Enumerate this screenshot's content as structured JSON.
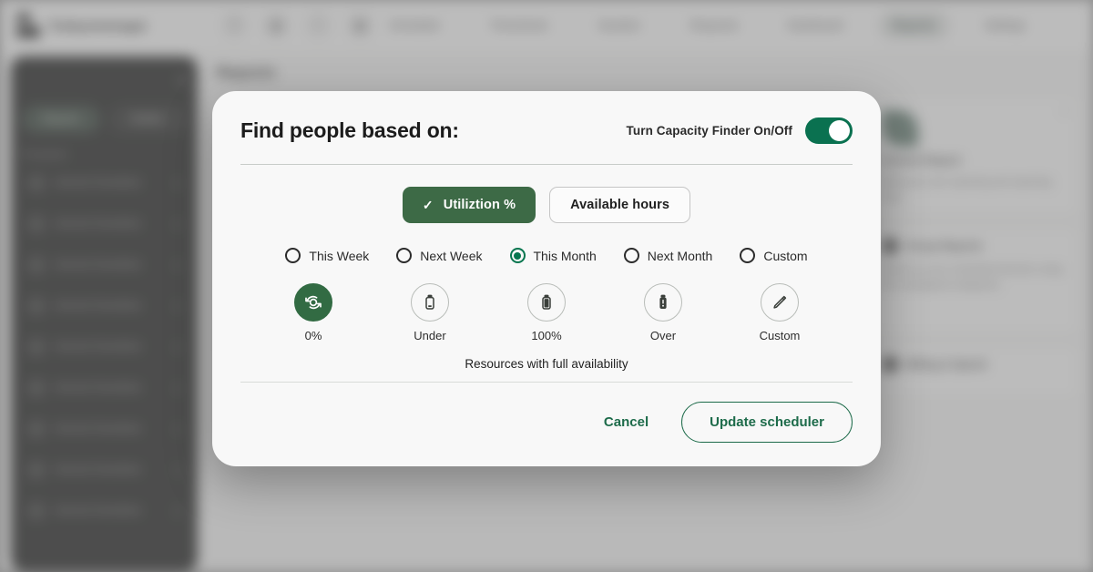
{
  "topnav": {
    "brand": "Todaysmanagar",
    "icons": [
      "search-icon",
      "grid-icon",
      "bell-icon",
      "briefcase-icon"
    ],
    "links": [
      {
        "label": "Scheduler",
        "active": false
      },
      {
        "label": "Timesheets",
        "active": false
      },
      {
        "label": "Vacation",
        "active": false
      },
      {
        "label": "Requests",
        "active": false
      },
      {
        "label": "Dashboard",
        "active": false
      },
      {
        "label": "Reports",
        "active": true
      },
      {
        "label": "Settings",
        "active": false
      }
    ]
  },
  "sidebar": {
    "segments": [
      {
        "label": "Reports",
        "active": true
      },
      {
        "label": "Builder",
        "active": false
      }
    ],
    "section_label": "Templates",
    "items": [
      {
        "label": "Internal Schedules"
      },
      {
        "label": "Internal Schedules"
      },
      {
        "label": "Internal Schedules"
      },
      {
        "label": "Internal Schedules"
      },
      {
        "label": "Internal Schedules"
      },
      {
        "label": "Internal Schedules"
      },
      {
        "label": "Internal Schedules"
      },
      {
        "label": "Internal Schedules"
      },
      {
        "label": "Internal Schedules"
      }
    ]
  },
  "page": {
    "title": "Reports",
    "cards": [
      {
        "title": "Client Reports",
        "desc": "Check project health and progress and make sure they are on track."
      },
      {
        "title": "Utility Reports",
        "desc": "See how your team and how your team is performing and being utilized."
      },
      {
        "title": "Group Reports",
        "desc": "Report on your scheduled decision using the undesigned categories."
      },
      {
        "title": "Billing & Spend",
        "desc": "Track schedule and approved time."
      },
      {
        "title": "Custom Report",
        "desc": "Build your own reporting and reporting view."
      }
    ]
  },
  "modal": {
    "title": "Find people based on:",
    "toggle_label": "Turn Capacity Finder On/Off",
    "toggle_on": true,
    "mode_buttons": [
      {
        "label": "Utiliztion %",
        "selected": true,
        "icon": "check-icon"
      },
      {
        "label": "Available hours",
        "selected": false
      }
    ],
    "periods": [
      {
        "label": "This Week",
        "selected": false
      },
      {
        "label": "Next Week",
        "selected": false
      },
      {
        "label": "This Month",
        "selected": true
      },
      {
        "label": "Next Month",
        "selected": false
      },
      {
        "label": "Custom",
        "selected": false
      }
    ],
    "capacity_icons": [
      {
        "label": "0%",
        "icon": "refresh-circle-icon",
        "selected": true
      },
      {
        "label": "Under",
        "icon": "battery-empty-icon",
        "selected": false
      },
      {
        "label": "100%",
        "icon": "battery-full-icon",
        "selected": false
      },
      {
        "label": "Over",
        "icon": "battery-alert-icon",
        "selected": false
      },
      {
        "label": "Custom",
        "icon": "pencil-icon",
        "selected": false
      }
    ],
    "resources_note": "Resources  with full availability",
    "cancel_label": "Cancel",
    "update_label": "Update scheduler"
  },
  "colors": {
    "brand_green": "#3d6a46",
    "toggle_green": "#0a7150",
    "accent_green": "#1d6b4a",
    "modal_bg": "#f8f8f8"
  }
}
